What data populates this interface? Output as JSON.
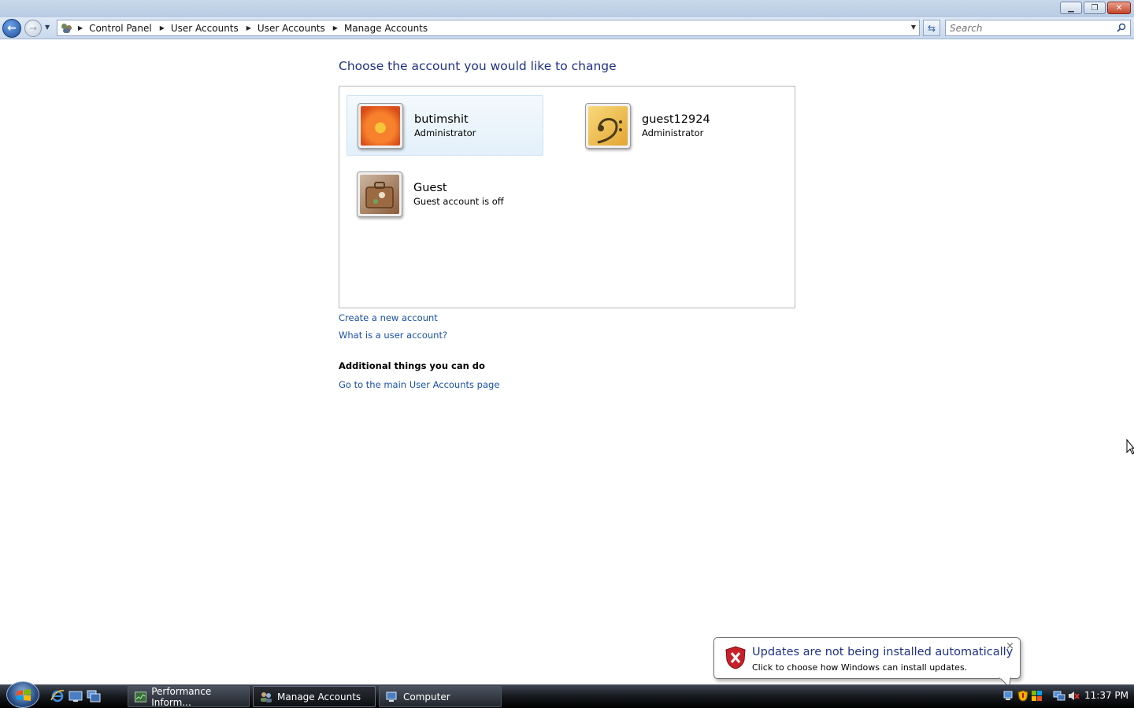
{
  "window": {
    "buttons": [
      "minimize",
      "restore",
      "close"
    ]
  },
  "nav": {
    "breadcrumbs": [
      "Control Panel",
      "User Accounts",
      "User Accounts",
      "Manage Accounts"
    ],
    "search_placeholder": "Search"
  },
  "main": {
    "heading": "Choose the account you would like to change",
    "accounts": [
      {
        "name": "butimshit",
        "type": "Administrator",
        "picture": "flower",
        "selected": true
      },
      {
        "name": "guest12924",
        "type": "Administrator",
        "picture": "bass-clef"
      },
      {
        "name": "Guest",
        "type": "Guest account is off",
        "picture": "briefcase"
      }
    ],
    "links": {
      "create": "Create a new account",
      "what_is": "What is a user account?"
    },
    "additional_heading": "Additional things you can do",
    "additional_links": [
      "Go to the main User Accounts page"
    ]
  },
  "balloon": {
    "title": "Updates are not being installed automatically",
    "text": "Click to choose how Windows can install updates.",
    "close": "×",
    "icon": "red-shield-x-icon"
  },
  "taskbar": {
    "tasks": [
      {
        "label": "Performance Inform...",
        "icon": "performance-icon"
      },
      {
        "label": "Manage Accounts",
        "icon": "user-accounts-icon",
        "active": true
      },
      {
        "label": "Computer",
        "icon": "computer-icon"
      }
    ],
    "clock": "11:37 PM"
  },
  "colors": {
    "heading": "#1e3287",
    "link": "#1a51a8",
    "selected_tile": "#e3f0fa"
  }
}
